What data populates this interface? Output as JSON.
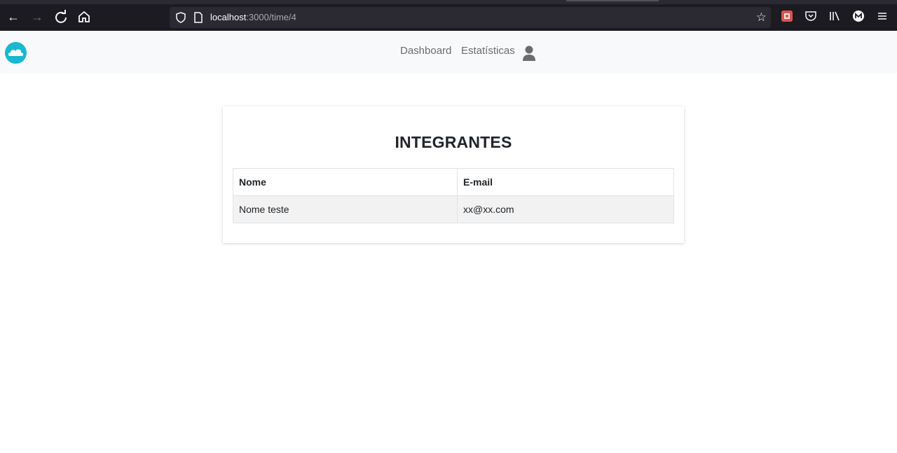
{
  "browser": {
    "url_host": "localhost",
    "url_path": ":3000/time/4"
  },
  "header": {
    "nav_links": [
      "Dashboard",
      "Estatísticas"
    ]
  },
  "colors": {
    "accent": "#17b8d0",
    "header_bg": "#f8f9fa",
    "browser_bg": "#1c1b22"
  },
  "icons": {
    "logo": "cloud-icon",
    "user": "user-icon"
  },
  "main": {
    "title": "INTEGRANTES",
    "table": {
      "columns": [
        "Nome",
        "E-mail"
      ],
      "rows": [
        [
          "Nome teste",
          "xx@xx.com"
        ]
      ]
    }
  }
}
